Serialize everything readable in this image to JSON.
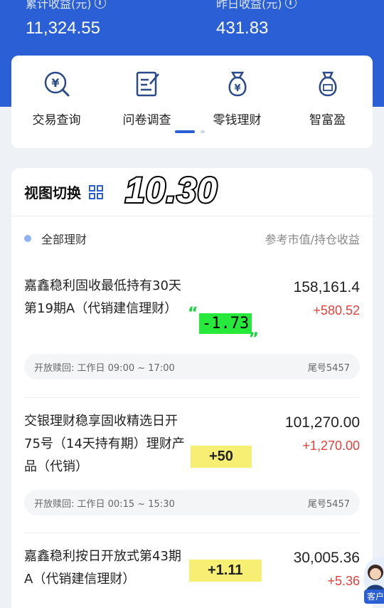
{
  "stats": {
    "cumulative": {
      "label": "累计收益(元)",
      "value": "11,324.55"
    },
    "yesterday": {
      "label": "昨日收益(元)",
      "value": "431.83"
    }
  },
  "quick_actions": [
    {
      "label": "交易查询",
      "icon": "yen-search-icon"
    },
    {
      "label": "问卷调查",
      "icon": "survey-icon"
    },
    {
      "label": "零钱理财",
      "icon": "money-bag-icon"
    },
    {
      "label": "智富盈",
      "icon": "wealth-bag-icon"
    }
  ],
  "portfolio": {
    "title": "视图切换",
    "overlay_date": "10.30",
    "filter_label": "全部理财",
    "column_header": "参考市值/持仓收益"
  },
  "products": [
    {
      "name": "嘉鑫稳利固收最低持有30天第19期A（代销建信理财）",
      "value": "158,161.4",
      "gain": "+580.52",
      "open_time": "开放赎回: 工作日 09:00 ~ 17:00",
      "tail": "尾号5457",
      "annotation": "-1.73"
    },
    {
      "name": "交银理财稳享固收精选日开75号（14天持有期）理财产品（代销）",
      "value": "101,270.00",
      "gain": "+1,270.00",
      "open_time": "开放赎回: 工作日 00:15 ~ 15:30",
      "tail": "尾号5457",
      "annotation": "+50"
    },
    {
      "name": "嘉鑫稳利按日开放式第43期A（代销建信理财）",
      "value": "30,005.36",
      "gain": "+5.36",
      "annotation": "+1.11"
    }
  ],
  "service": {
    "label": "客户"
  },
  "colors": {
    "brand": "#2a5fd6",
    "gain": "#e5403c"
  }
}
